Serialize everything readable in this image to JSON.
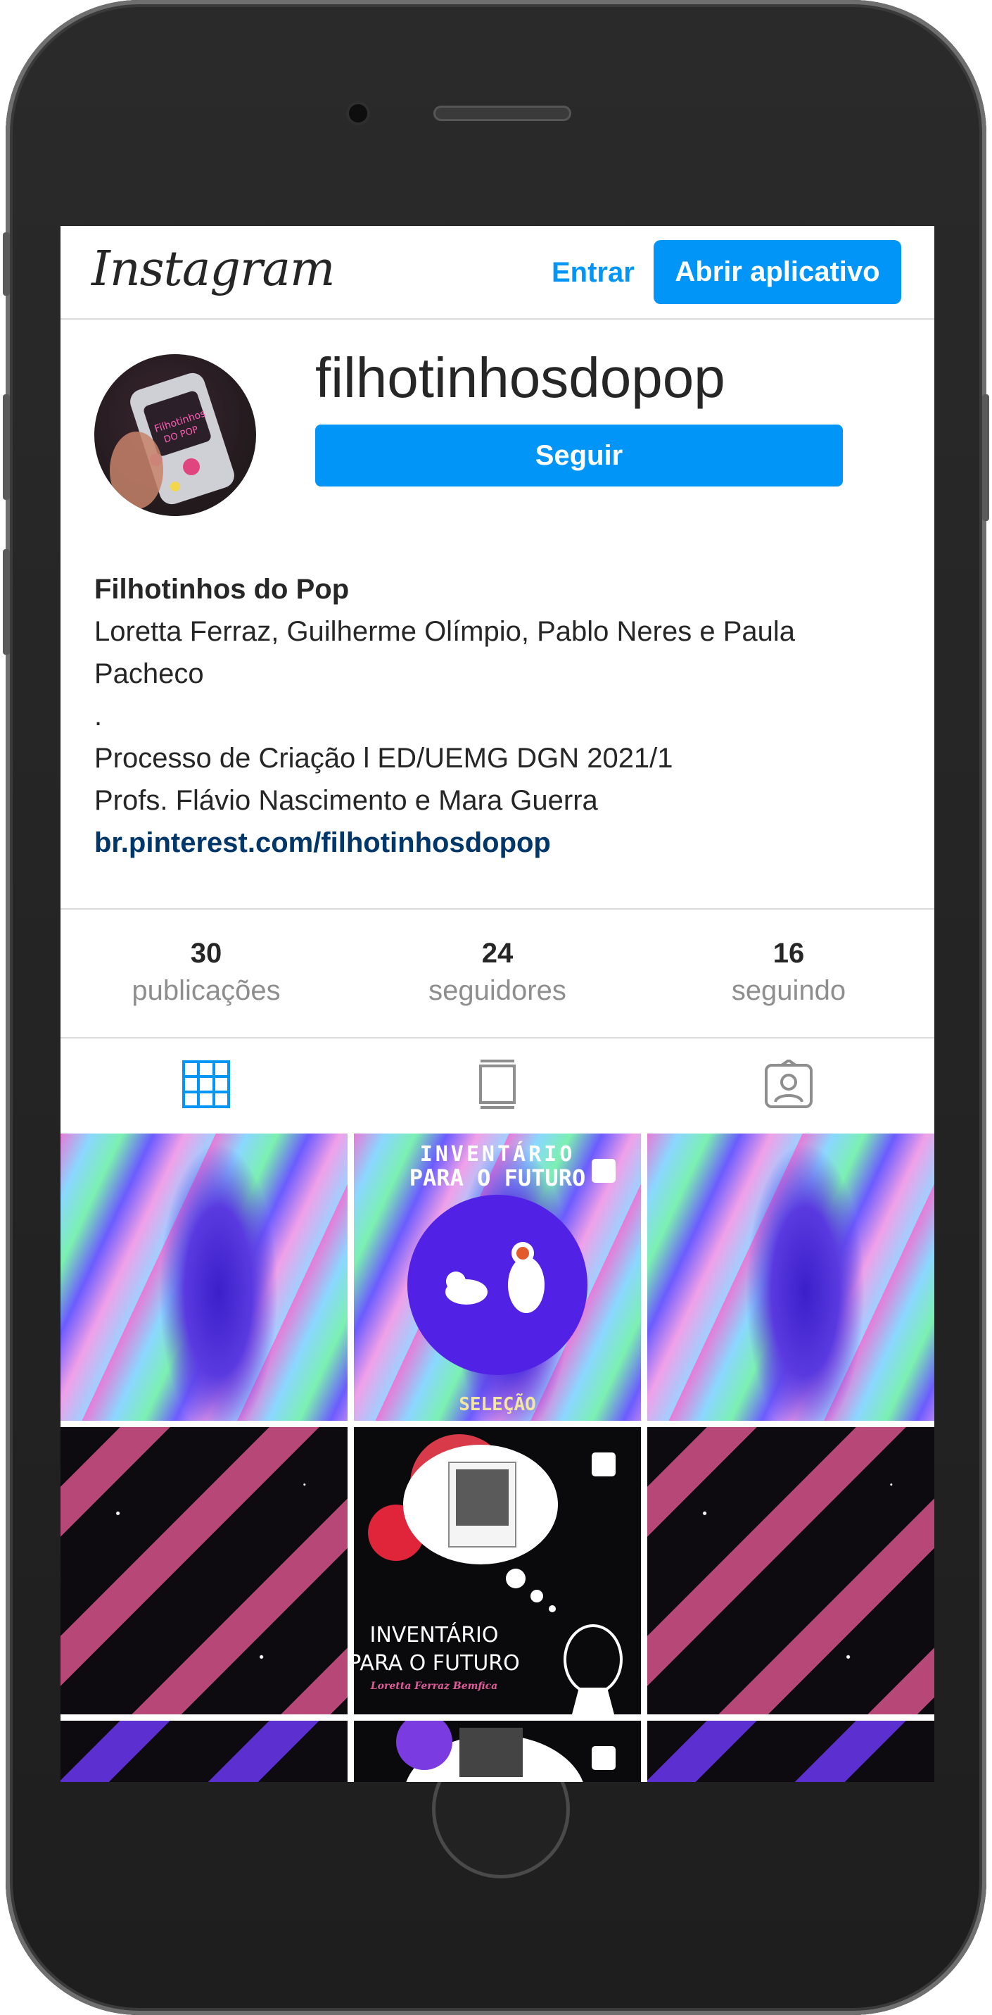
{
  "topbar": {
    "logo_text": "Instagram",
    "login_label": "Entrar",
    "open_app_label": "Abrir aplicativo"
  },
  "profile": {
    "username": "filhotinhosdopop",
    "follow_label": "Seguir",
    "display_name": "Filhotinhos do Pop",
    "bio_lines": [
      "Loretta Ferraz, Guilherme Olímpio, Pablo Neres e Paula Pacheco",
      ".",
      "Processo de Criação l ED/UEMG DGN 2021/1",
      "Profs. Flávio Nascimento e Mara Guerra"
    ],
    "link": "br.pinterest.com/filhotinhosdopop"
  },
  "stats": [
    {
      "value": "30",
      "label": "publicações"
    },
    {
      "value": "24",
      "label": "seguidores"
    },
    {
      "value": "16",
      "label": "seguindo"
    }
  ],
  "tabs": [
    {
      "icon": "grid-icon",
      "active": true
    },
    {
      "icon": "feed-icon",
      "active": false
    },
    {
      "icon": "tagged-icon",
      "active": false
    }
  ],
  "posts": {
    "post2_title_1": "INVENTÁRIO",
    "post2_title_2": "PARA O FUTURO",
    "post2_footer": "SELEÇÃO",
    "post5_title_1": "INVENTÁRIO",
    "post5_title_2": "PARA O FUTURO",
    "post5_author": "Loretta Ferraz Bemfica"
  },
  "colors": {
    "accent": "#0095f6",
    "link": "#00376b",
    "text": "#262626",
    "muted": "#8e8e8e"
  }
}
